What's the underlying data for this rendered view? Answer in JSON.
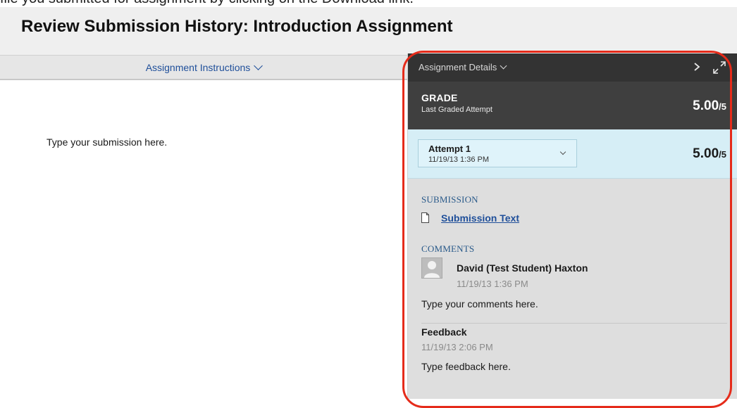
{
  "caption": {
    "text": "file you submitted for assignment by clicking on the Download link."
  },
  "header": {
    "title": "Review Submission History: Introduction Assignment"
  },
  "instructions": {
    "toggle_label": "Assignment Instructions",
    "body_text": "Type your submission here."
  },
  "details": {
    "toggle_label": "Assignment Details",
    "grade": {
      "label": "GRADE",
      "sublabel": "Last Graded Attempt",
      "score": "5.00",
      "out_of": "/5"
    },
    "attempt": {
      "name": "Attempt 1",
      "date": "11/19/13 1:36 PM",
      "score": "5.00",
      "out_of": "/5"
    },
    "submission": {
      "heading": "SUBMISSION",
      "file_link": "Submission Text"
    },
    "comments": {
      "heading": "COMMENTS",
      "author": "David (Test Student) Haxton",
      "date": "11/19/13 1:36 PM",
      "text": "Type your comments here."
    },
    "feedback": {
      "label": "Feedback",
      "date": "11/19/13 2:06 PM",
      "text": "Type feedback here."
    }
  },
  "colors": {
    "highlight_ring": "#e52b1a",
    "panel_header": "#333333",
    "grade_row": "#3f3f3f",
    "attempt_row": "#d6eef6",
    "link": "#1f4f9a"
  },
  "icons": [
    "chevron-down-icon",
    "chevron-right-icon",
    "expand-icon",
    "document-icon",
    "avatar"
  ]
}
